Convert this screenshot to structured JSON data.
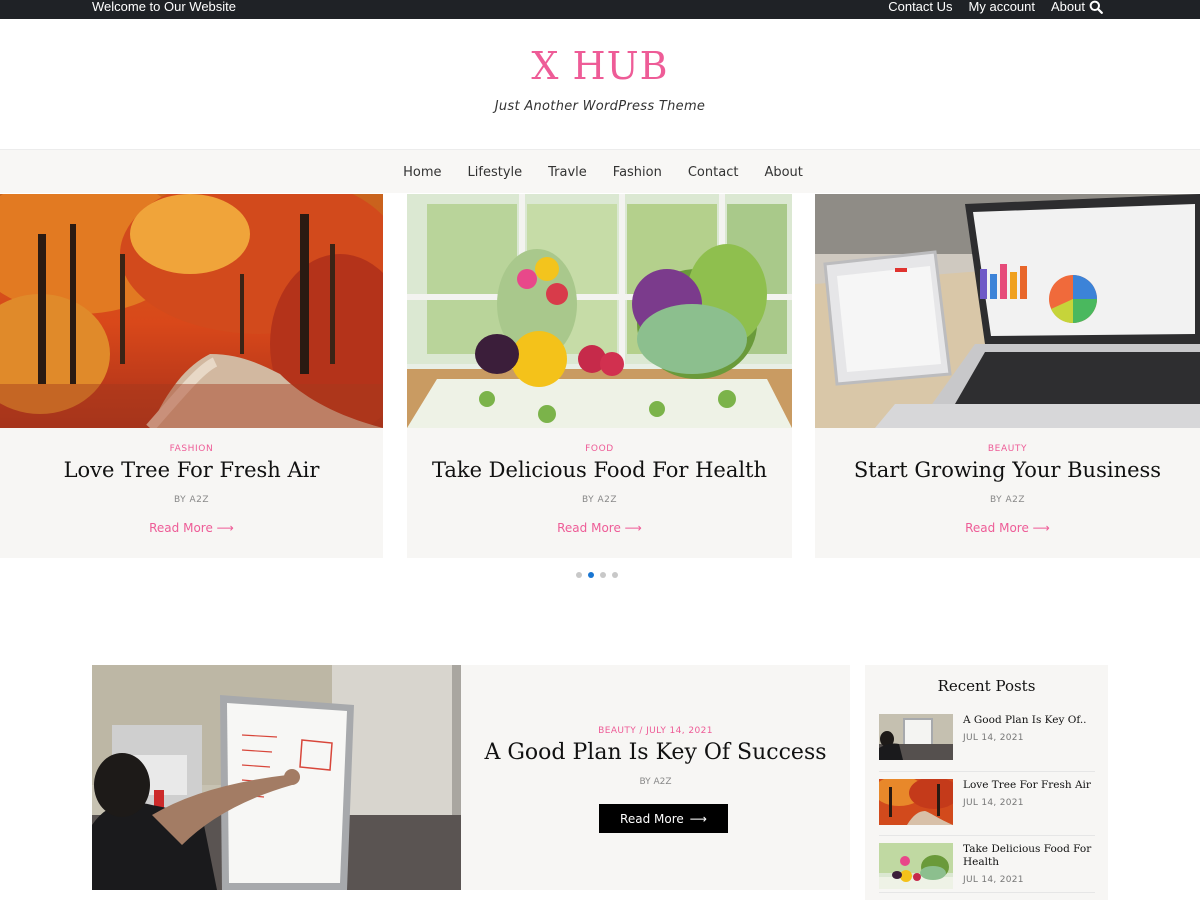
{
  "topbar": {
    "welcome": "Welcome to Our Website",
    "links": [
      "Contact Us",
      "My account",
      "About"
    ]
  },
  "header": {
    "site_title": "X HUB",
    "tagline": "Just Another WordPress Theme"
  },
  "nav": {
    "items": [
      "Home",
      "Lifestyle",
      "Travle",
      "Fashion",
      "Contact",
      "About"
    ]
  },
  "slider": {
    "cards": [
      {
        "category": "FASHION",
        "title": "Love Tree For Fresh Air",
        "author": "BY A2Z",
        "read_more": "Read More"
      },
      {
        "category": "FOOD",
        "title": "Take Delicious Food For Health",
        "author": "BY A2Z",
        "read_more": "Read More"
      },
      {
        "category": "BEAUTY",
        "title": "Start Growing Your Business",
        "author": "BY A2Z",
        "read_more": "Read More"
      }
    ],
    "active_dot": 2
  },
  "featured": {
    "meta": "BEAUTY / JULY 14, 2021",
    "title": "A Good Plan Is Key Of Success",
    "author": "BY A2Z",
    "button": "Read More"
  },
  "sidebar": {
    "title": "Recent Posts",
    "posts": [
      {
        "title": "A Good Plan Is Key Of..",
        "date": "JUL 14, 2021"
      },
      {
        "title": "Love Tree For Fresh Air",
        "date": "JUL 14, 2021"
      },
      {
        "title": "Take Delicious Food For Health",
        "date": "JUL 14, 2021"
      }
    ]
  },
  "colors": {
    "accent": "#ee5c97",
    "topbar": "#1f2226",
    "dot_active": "#1976d2"
  }
}
